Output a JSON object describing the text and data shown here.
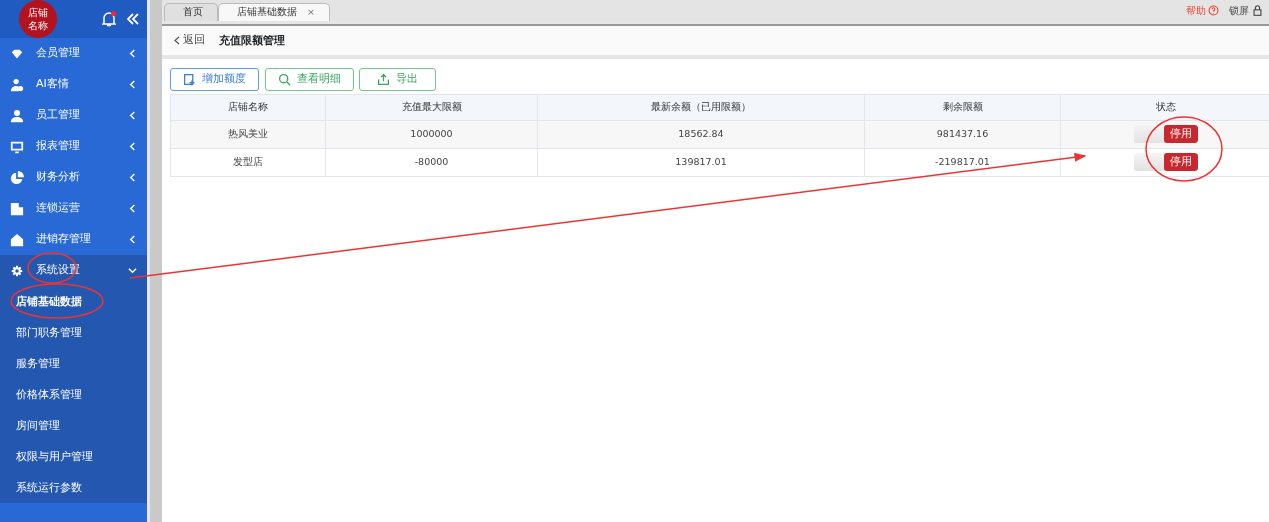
{
  "sidebar": {
    "logo": [
      "店铺",
      "名称"
    ],
    "notification": true,
    "menu": [
      {
        "label": "会员管理",
        "expanded": false
      },
      {
        "label": "AI客情",
        "expanded": false
      },
      {
        "label": "员工管理",
        "expanded": false
      },
      {
        "label": "报表管理",
        "expanded": false
      },
      {
        "label": "财务分析",
        "expanded": false
      },
      {
        "label": "连锁运营",
        "expanded": false
      },
      {
        "label": "进销存管理",
        "expanded": false
      },
      {
        "label": "系统设置",
        "expanded": true,
        "children": [
          {
            "label": "店铺基础数据",
            "selected": true
          },
          {
            "label": "部门职务管理",
            "selected": false
          },
          {
            "label": "服务管理",
            "selected": false
          },
          {
            "label": "价格体系管理",
            "selected": false
          },
          {
            "label": "房间管理",
            "selected": false
          },
          {
            "label": "权限与用户管理",
            "selected": false
          },
          {
            "label": "系统运行参数",
            "selected": false
          }
        ]
      }
    ]
  },
  "tabs": [
    {
      "label": "首页",
      "selected": false,
      "closable": false
    },
    {
      "label": "店铺基础数据",
      "selected": true,
      "closable": true,
      "close": "×"
    }
  ],
  "top_links": [
    {
      "label": "帮助"
    },
    {
      "label": "锁屏"
    }
  ],
  "breadcrumb": {
    "back": "返回",
    "title": "充值限额管理"
  },
  "toolbar": [
    {
      "label": "增加额度",
      "kind": "primary"
    },
    {
      "label": "查看明细",
      "kind": "success"
    },
    {
      "label": "导出",
      "kind": "success"
    }
  ],
  "table": {
    "columns": [
      "店铺名称",
      "充值最大限额",
      "最新余额（已用限额）",
      "剩余限额",
      "状态"
    ],
    "rows": [
      {
        "cells": [
          "热风美业",
          "1000000",
          "18562.84",
          "981437.16"
        ],
        "status": {
          "label": "停用",
          "on": false
        }
      },
      {
        "cells": [
          "发型店",
          "-80000",
          "139817.01",
          "-219817.01"
        ],
        "status": {
          "label": "停用",
          "on": false
        }
      }
    ]
  },
  "annotations": [
    {
      "kind": "circle"
    },
    {
      "kind": "circle"
    },
    {
      "kind": "circle"
    },
    {
      "kind": "arrow"
    }
  ]
}
